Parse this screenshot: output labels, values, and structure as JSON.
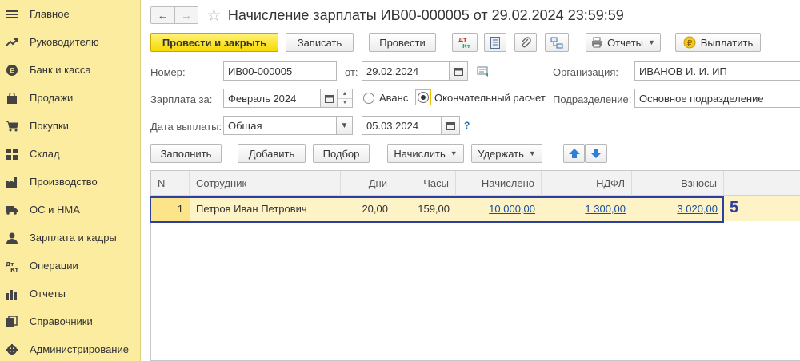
{
  "sidebar": {
    "items": [
      {
        "label": "Главное",
        "icon": "hamburger-icon"
      },
      {
        "label": "Руководителю",
        "icon": "trend-icon"
      },
      {
        "label": "Банк и касса",
        "icon": "ruble-coin-icon"
      },
      {
        "label": "Продажи",
        "icon": "shopping-bag-icon"
      },
      {
        "label": "Покупки",
        "icon": "cart-icon"
      },
      {
        "label": "Склад",
        "icon": "warehouse-icon"
      },
      {
        "label": "Производство",
        "icon": "factory-icon"
      },
      {
        "label": "ОС и НМА",
        "icon": "truck-icon"
      },
      {
        "label": "Зарплата и кадры",
        "icon": "person-icon"
      },
      {
        "label": "Операции",
        "icon": "dt-kt-icon"
      },
      {
        "label": "Отчеты",
        "icon": "bar-chart-icon"
      },
      {
        "label": "Справочники",
        "icon": "books-icon"
      },
      {
        "label": "Администрирование",
        "icon": "gear-icon"
      }
    ]
  },
  "header": {
    "title": "Начисление зарплаты ИВ00-000005 от 29.02.2024 23:59:59"
  },
  "toolbar": {
    "post_close_label": "Провести и закрыть",
    "save_label": "Записать",
    "post_label": "Провести",
    "reports_label": "Отчеты",
    "pay_label": "Выплатить"
  },
  "form": {
    "number_label": "Номер:",
    "number_value": "ИВ00-000005",
    "from_label": "от:",
    "date_value": "29.02.2024",
    "org_label": "Организация:",
    "org_value": "ИВАНОВ И. И. ИП",
    "salary_for_label": "Зарплата за:",
    "salary_for_value": "Февраль 2024",
    "advance_label": "Аванс",
    "final_label": "Окончательный расчет",
    "dept_label": "Подразделение:",
    "dept_value": "Основное подразделение",
    "pay_date_label": "Дата выплаты:",
    "pay_date_type": "Общая",
    "pay_date_value": "05.03.2024",
    "help_label": "?"
  },
  "table_toolbar": {
    "fill_label": "Заполнить",
    "add_label": "Добавить",
    "select_label": "Подбор",
    "accrue_label": "Начислить",
    "withhold_label": "Удержать"
  },
  "table": {
    "columns": [
      "N",
      "Сотрудник",
      "Дни",
      "Часы",
      "Начислено",
      "НДФЛ",
      "Взносы"
    ],
    "rows": [
      {
        "n": "1",
        "employee": "Петров Иван Петрович",
        "days": "20,00",
        "hours": "159,00",
        "accrued": "10 000,00",
        "ndfl": "1 300,00",
        "contrib": "3 020,00"
      }
    ]
  },
  "annotation": {
    "step": "5",
    "color": "#2f3f9c"
  }
}
